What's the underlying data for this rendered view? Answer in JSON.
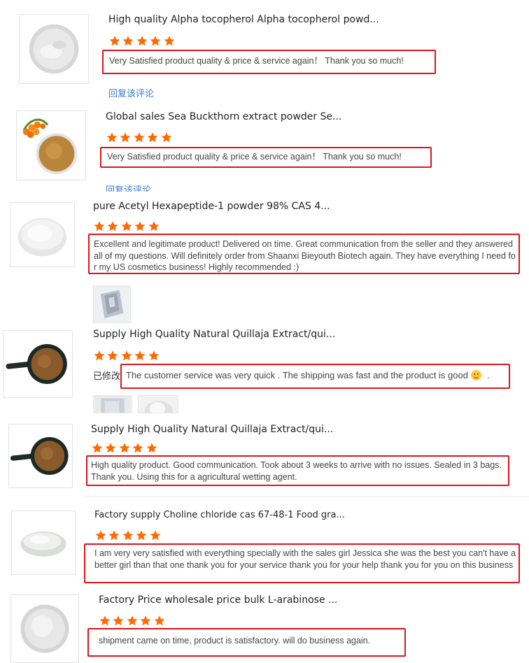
{
  "reviews": [
    {
      "title": "High quality Alpha tocopherol Alpha tocopherol powd...",
      "rating": 5,
      "comment": "Very Satisfied product quality & price & service again！ Thank you so much!",
      "reply_link": "回复该评论",
      "image_icon": "white-powder-image"
    },
    {
      "title": "Global sales Sea Buckthorn extract powder Se...",
      "rating": 5,
      "comment": "Very Satisfied product quality & price & service again！ Thank you so much!",
      "reply_link": "回复该评论",
      "image_icon": "brown-powder-with-berries-image"
    },
    {
      "title": "pure Acetyl Hexapeptide-1 powder 98% CAS 4...",
      "rating": 5,
      "comment": "Excellent and legitimate product! Delivered on time. Great communication from the seller and they answered all of my questions. Will definitely order from Shaanxi Bieyouth Biotech again. They have everything I need for my US cosmetics business! Highly recommended :)",
      "image_icon": "white-powder-bowl-image",
      "attachments": [
        "foil-bag-photo"
      ]
    },
    {
      "title": "Supply High Quality Natural Quillaja Extract/qui...",
      "rating": 5,
      "modified_label": "已修改",
      "comment": "The customer service was very quick . The shipping was fast and the product is good",
      "comment_suffix": ".",
      "image_icon": "brown-powder-pan-image",
      "attachments": [
        "powder-bag-photo",
        "white-powder-photo"
      ]
    },
    {
      "title": "Supply High Quality Natural Quillaja Extract/qui...",
      "rating": 5,
      "comment": "High quality product. Good communication.  Took about 3 weeks to arrive with no issues.  Sealed in 3 bags.  Thank you.  Using this for a agricultural wetting agent.",
      "image_icon": "brown-powder-pan-image"
    },
    {
      "title": "Factory supply Choline chloride cas 67-48-1 Food gra...",
      "rating": 5,
      "comment": "I am very very satisfied with everything specially with the sales girl Jessica she was the best you can't have a better girl than that one thank you for your service thank you for your help thank you for you on this business",
      "image_icon": "white-powder-dish-image"
    },
    {
      "title": "Factory Price wholesale price bulk L-arabinose ...",
      "rating": 5,
      "comment": "shipment came on time, product is satisfactory. will do business again.",
      "image_icon": "white-powder-pile-image"
    }
  ],
  "colors": {
    "star": "#ff6a00",
    "highlight_border": "#e0131c",
    "link": "#3a7bd5"
  }
}
